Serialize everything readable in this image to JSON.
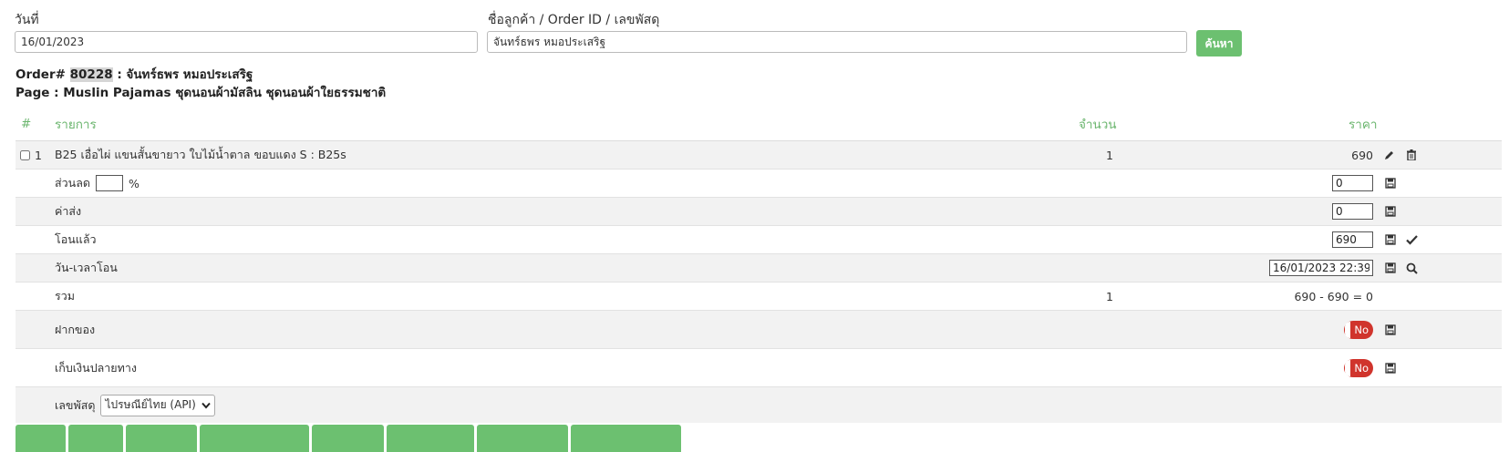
{
  "search": {
    "date_label": "วันที่",
    "date_value": "16/01/2023",
    "customer_label": "ชื่อลูกค้า / Order ID / เลขพัสดุ",
    "customer_value": "จันทร์ธพร หมอประเสริฐ",
    "search_button": "ค้นหา"
  },
  "order": {
    "prefix": "Order#",
    "id": "80228",
    "customer": ": จันทร์ธพร หมอประเสริฐ",
    "page_line": "Page : Muslin Pajamas ชุดนอนผ้ามัสลิน ชุดนอนผ้าใยธรรมชาติ"
  },
  "table": {
    "headers": {
      "num": "#",
      "item": "รายการ",
      "qty": "จำนวน",
      "price": "ราคา"
    },
    "item": {
      "index": "1",
      "name": "B25 เอื่อไผ่ แขนสั้นขายาว ใบไม้น้ำตาล ขอบแดง S : B25s",
      "qty": "1",
      "price": "690"
    },
    "discount": {
      "label": "ส่วนลด",
      "percent_value": "",
      "percent_sign": "%",
      "value": "0"
    },
    "shipping": {
      "label": "ค่าส่ง",
      "value": "0"
    },
    "transferred": {
      "label": "โอนแล้ว",
      "value": "690"
    },
    "transfer_time": {
      "label": "วัน-เวลาโอน",
      "value": "16/01/2023 22:39"
    },
    "total": {
      "label": "รวม",
      "qty": "1",
      "value": "690 - 690 = 0"
    },
    "deposit": {
      "label": "ฝากของ",
      "toggle": "No"
    },
    "cod": {
      "label": "เก็บเงินปลายทาง",
      "toggle": "No"
    },
    "tracking": {
      "label": "เลขพัสดุ",
      "carrier": "ไปรษณีย์ไทย (API)"
    }
  },
  "colors": {
    "accent": "#6cc070",
    "toggle_off": "#d0342c",
    "header_text": "#6cb66f"
  },
  "icons": [
    "pencil-icon",
    "trash-icon",
    "save-icon",
    "check-icon",
    "search-icon",
    "chevron-down-icon"
  ]
}
